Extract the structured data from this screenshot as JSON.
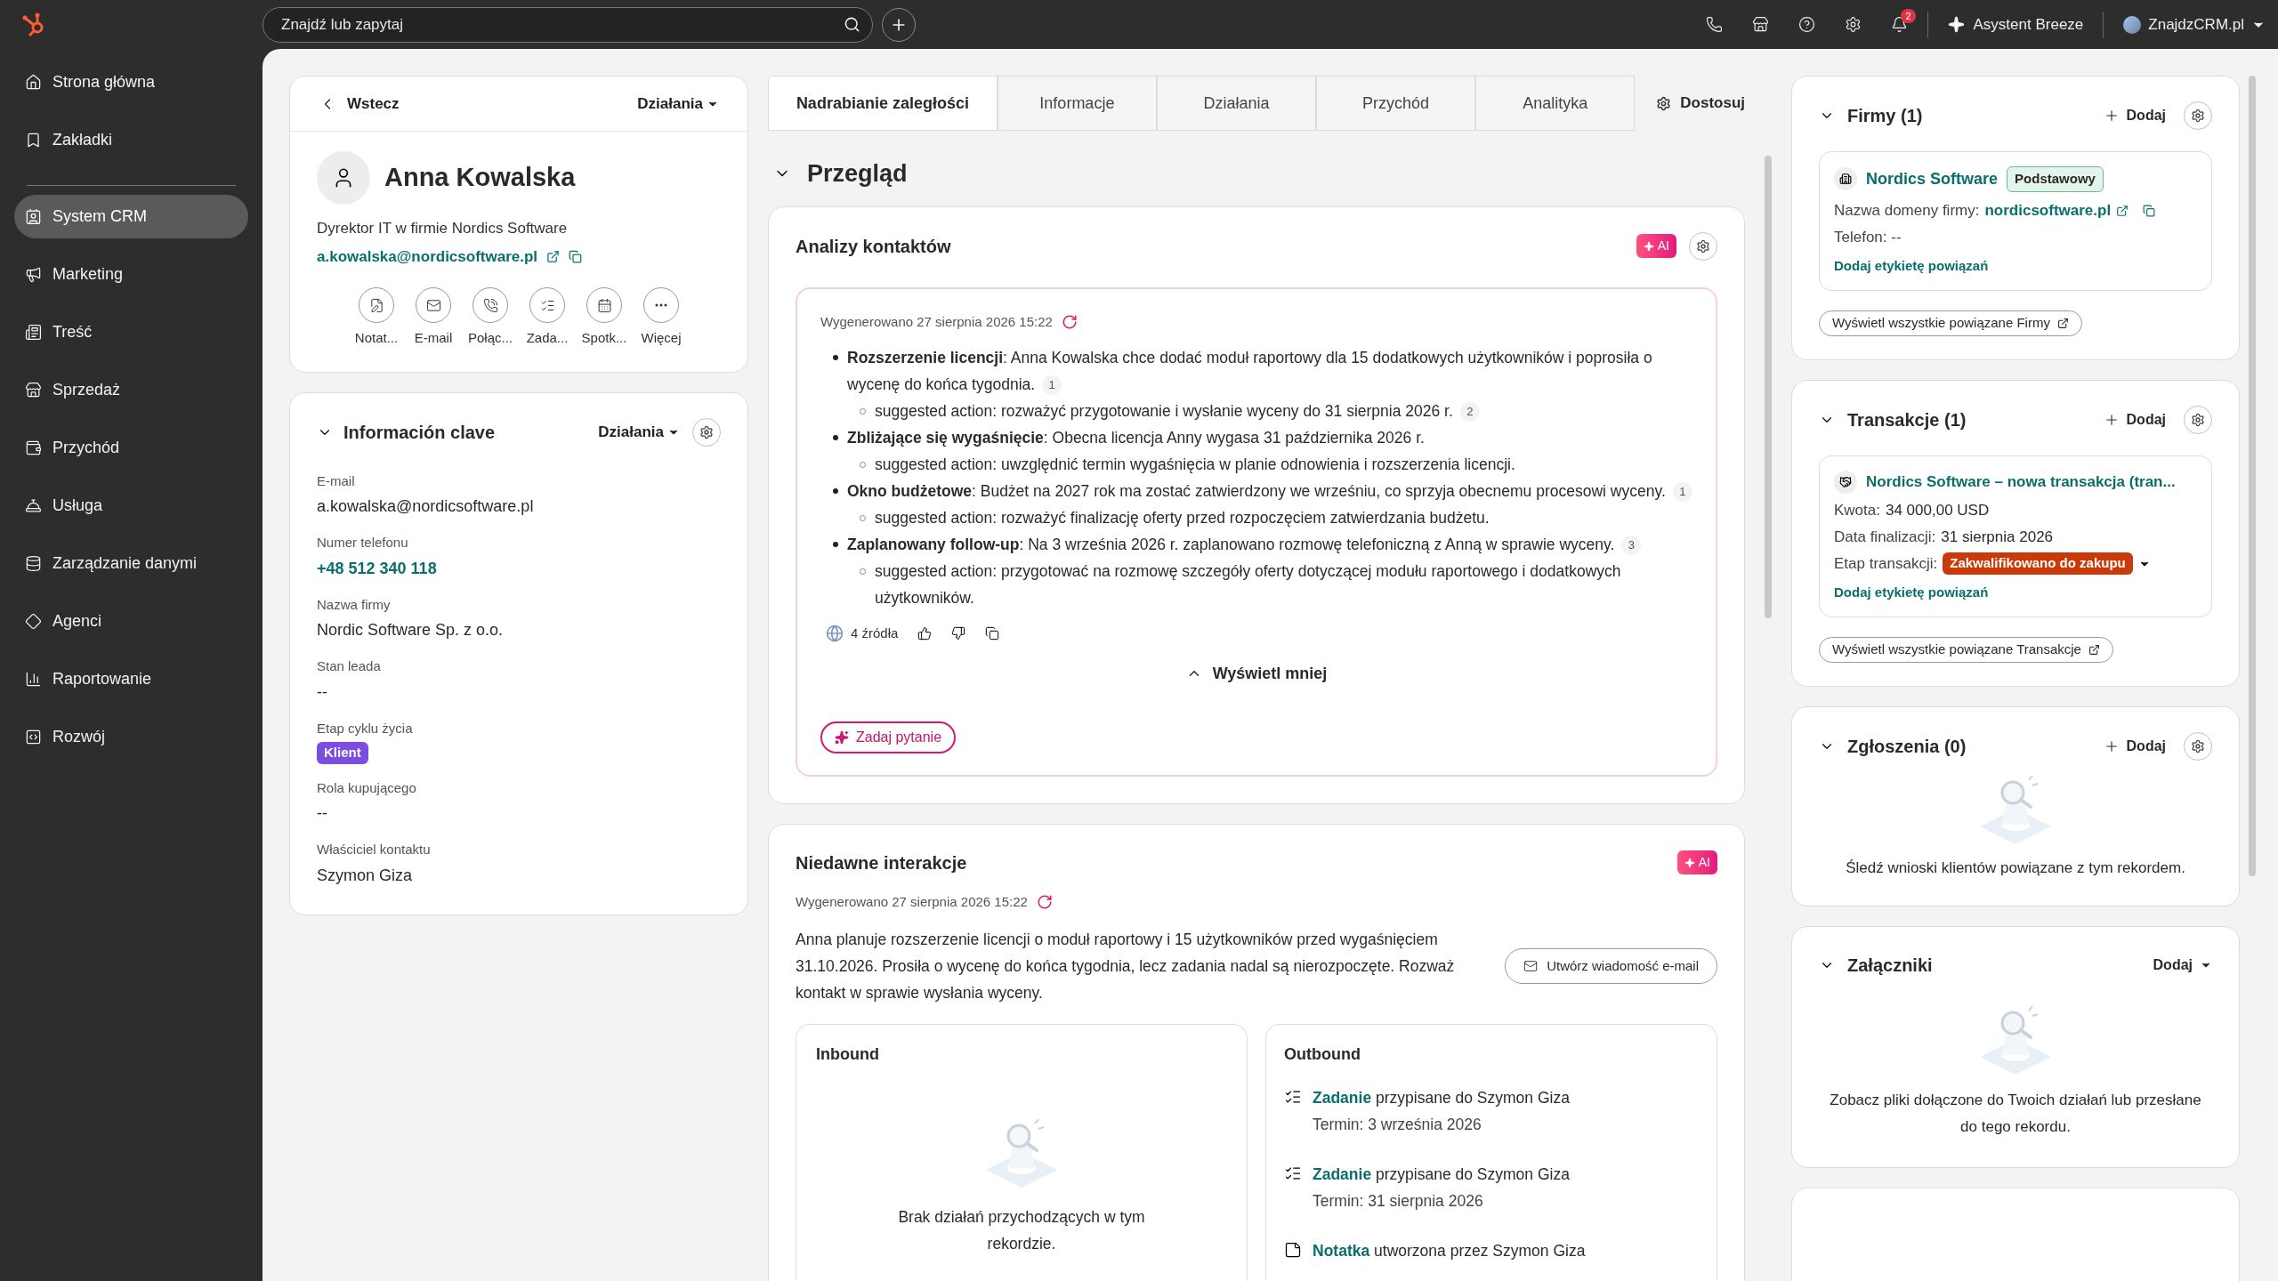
{
  "topbar": {
    "search_placeholder": "Znajdź lub zapytaj",
    "notification_count": "2",
    "assistant": "Asystent Breeze",
    "account": "ZnajdzCRM.pl"
  },
  "sidebar": {
    "items": [
      {
        "label": "Strona główna",
        "selected": false
      },
      {
        "label": "Zakładki",
        "selected": false
      },
      {
        "label": "System CRM",
        "selected": true
      },
      {
        "label": "Marketing",
        "selected": false
      },
      {
        "label": "Treść",
        "selected": false
      },
      {
        "label": "Sprzedaż",
        "selected": false
      },
      {
        "label": "Przychód",
        "selected": false
      },
      {
        "label": "Usługa",
        "selected": false
      },
      {
        "label": "Zarządzanie danymi",
        "selected": false
      },
      {
        "label": "Agenci",
        "selected": false
      },
      {
        "label": "Raportowanie",
        "selected": false
      },
      {
        "label": "Rozwój",
        "selected": false
      }
    ]
  },
  "contact": {
    "back": "Wstecz",
    "actions": "Działania",
    "name": "Anna Kowalska",
    "job": "Dyrektor IT w firmie Nordics Software",
    "email": "a.kowalska@nordicsoftware.pl",
    "quick_actions": [
      "Notat...",
      "E-mail",
      "Połąc...",
      "Zada...",
      "Spotk...",
      "Więcej"
    ]
  },
  "key_info": {
    "title": "Información clave",
    "actions": "Działania",
    "fields": [
      {
        "label": "E-mail",
        "value": "a.kowalska@nordicsoftware.pl",
        "kind": "text"
      },
      {
        "label": "Numer telefonu",
        "value": "+48 512 340 118",
        "kind": "link"
      },
      {
        "label": "Nazwa firmy",
        "value": "Nordic Software Sp. z o.o.",
        "kind": "text"
      },
      {
        "label": "Stan leada",
        "value": "--",
        "kind": "text"
      },
      {
        "label": "Etap cyklu życia",
        "value": "Klient",
        "kind": "badge"
      },
      {
        "label": "Rola kupującego",
        "value": "--",
        "kind": "text"
      },
      {
        "label": "Właściciel kontaktu",
        "value": "Szymon Giza",
        "kind": "text"
      }
    ]
  },
  "tabs": [
    {
      "label": "Nadrabianie zaległości",
      "selected": true
    },
    {
      "label": "Informacje",
      "selected": false
    },
    {
      "label": "Działania",
      "selected": false
    },
    {
      "label": "Przychód",
      "selected": false
    },
    {
      "label": "Analityka",
      "selected": false
    }
  ],
  "customize": "Dostosuj",
  "section_title": "Przegląd",
  "insights": {
    "title": "Analizy kontaktów",
    "ai_badge": "AI",
    "generated": "Wygenerowano 27 sierpnia 2026 15:22",
    "bullets": [
      {
        "text": "**Rozszerzenie licencji**: Anna Kowalska chce dodać moduł raportowy dla 15 dodatkowych użytkowników i poprosiła o wycenę do końca tygodnia.",
        "cite": "1",
        "action": "suggested action: rozważyć przygotowanie i wysłanie wyceny do 31 sierpnia 2026 r.",
        "action_cite": "2"
      },
      {
        "text": "**Zbliżające się wygaśnięcie**: Obecna licencja Anny wygasa 31 października 2026 r.",
        "action": "suggested action: uwzględnić termin wygaśnięcia w planie odnowienia i rozszerzenia licencji."
      },
      {
        "text": "**Okno budżetowe**: Budżet na 2027 rok ma zostać zatwierdzony we wrześniu, co sprzyja obecnemu procesowi wyceny.",
        "cite": "1",
        "action": "suggested action: rozważyć finalizację oferty przed rozpoczęciem zatwierdzania budżetu."
      },
      {
        "text": "**Zaplanowany follow-up**: Na 3 września 2026 r. zaplanowano rozmowę telefoniczną z Anną w sprawie wyceny.",
        "cite": "3",
        "action": "suggested action: przygotować na rozmowę szczegóły oferty dotyczącej modułu raportowego i dodatkowych użytkowników."
      }
    ],
    "sources": "4 źródła",
    "show_less": "Wyświetl mniej",
    "ask": "Zadaj pytanie"
  },
  "recent": {
    "title": "Niedawne interakcje",
    "ai_badge": "AI",
    "generated": "Wygenerowano 27 sierpnia 2026 15:22",
    "summary": "Anna planuje rozszerzenie licencji o moduł raportowy i 15 użytkowników przed wygaśnięciem 31.10.2026. Prosiła o wycenę do końca tygodnia, lecz zadania nadal są nierozpoczęte. Rozważ kontakt w sprawie wysłania wyceny.",
    "email_button": "Utwórz wiadomość e-mail",
    "inbound": {
      "title": "Inbound",
      "empty_text": "Brak działań przychodzących w tym rekordzie."
    },
    "outbound": {
      "title": "Outbound",
      "items": [
        {
          "kind": "task",
          "link": "Zadanie",
          "text": "przypisane do Szymon Giza",
          "due": "Termin: 3 września 2026"
        },
        {
          "kind": "task",
          "link": "Zadanie",
          "text": "przypisane do Szymon Giza",
          "due": "Termin: 31 sierpnia 2026"
        },
        {
          "kind": "note",
          "link": "Notatka",
          "text": "utworzona przez Szymon Giza"
        }
      ]
    }
  },
  "companies": {
    "title": "Firmy (1)",
    "add": "Dodaj",
    "name": "Nordics Software",
    "tag": "Podstawowy",
    "domain_label": "Nazwa domeny firmy:",
    "domain": "nordicsoftware.pl",
    "phone": "Telefon: --",
    "add_label": "Dodaj etykietę powiązań",
    "view_all": "Wyświetl wszystkie powiązane Firmy"
  },
  "deals": {
    "title": "Transakcje (1)",
    "add": "Dodaj",
    "name": "Nordics Software – nowa transakcja (tran...",
    "amount_label": "Kwota:",
    "amount": "34 000,00 USD",
    "close_label": "Data finalizacji:",
    "close": "31 sierpnia 2026",
    "stage_label": "Etap transakcji:",
    "stage": "Zakwalifikowano do zakupu",
    "add_label": "Dodaj etykietę powiązań",
    "view_all": "Wyświetl wszystkie powiązane Transakcje"
  },
  "tickets": {
    "title": "Zgłoszenia (0)",
    "add": "Dodaj",
    "empty_text": "Śledź wnioski klientów powiązane z tym rekordem."
  },
  "attachments": {
    "title": "Załączniki",
    "add": "Dodaj",
    "empty_text": "Zobacz pliki dołączone do Twoich działań lub przesłane do tego rekordu."
  }
}
